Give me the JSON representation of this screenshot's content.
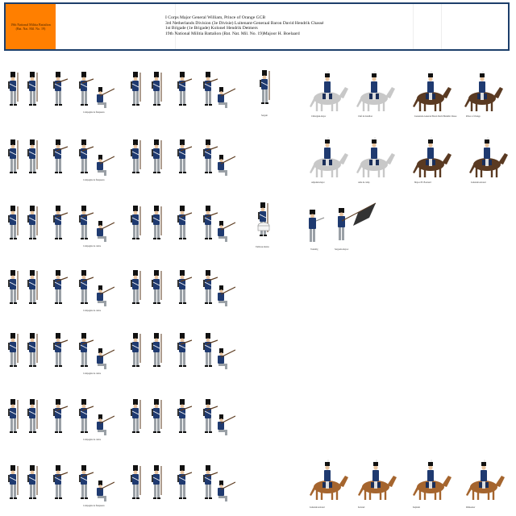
{
  "header": {
    "box_label": "19th National Militia Battalion (Bat. Nat. Mil. No. 19)",
    "lines": [
      "I Corps Major General William, Prince of Orange GCB",
      "3rd Netherlands Division (3e Divisie) Luitenant-Generaal Baron David Hendrik Chassé",
      "1st Brigade (1e Brigade) Kolonel Hendrik Detmers",
      "19th National Militia Battalion (Bat. Nat. Mil. No. 19)Majoor H. Boelaard"
    ]
  },
  "company_captions": [
    "Compagnie de flanqueurs",
    "Compagnie de flanqueurs",
    "Compagnie de centre",
    "Compagnie de centre",
    "Compagnie de centre",
    "Compagnie de centre",
    "Compagnie de flanqueurs"
  ],
  "extra_captions": {
    "sergeant": "Sergent",
    "drummer": "Tambour-maitre",
    "cav_r1": [
      "Chirurgien-major",
      "Chef de bataillon",
      "Lieutenant-Generaal Baron David Hendrik Chasse",
      "Prince of Orange"
    ],
    "cav_r2": [
      "Adjudant-major",
      "Aide de camp",
      "Majoor H. Boelaard",
      "Luitenant-kolonel"
    ],
    "foot_officers": [
      "Vaandrig",
      "Sergeant-majoor"
    ],
    "cav_bottom": [
      "Luitenant-kolonel",
      "Kolonel",
      "Kapitein",
      "Ritmeester"
    ]
  },
  "colors": {
    "accent": "#ff7f00",
    "frame": "#1d3f6b",
    "uniform_coat": "#1f3a70",
    "trousers": "#9aa0a6",
    "horse_grey": "#c8c8c8",
    "horse_bay": "#5a3a22",
    "horse_chestnut": "#a5652e"
  }
}
